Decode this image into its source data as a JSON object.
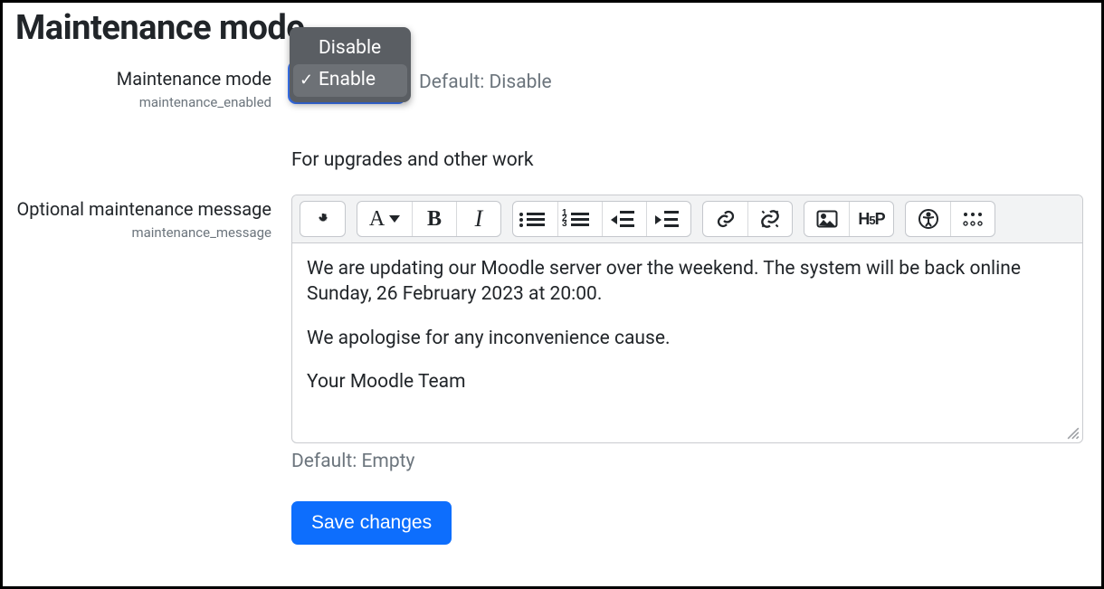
{
  "page_title": "Maintenance mode",
  "mode": {
    "label": "Maintenance mode",
    "key": "maintenance_enabled",
    "options": {
      "disable": "Disable",
      "enable": "Enable"
    },
    "selected": "Enable",
    "default_text": "Default: Disable",
    "help_text": "For upgrades and other work"
  },
  "message": {
    "label": "Optional maintenance message",
    "key": "maintenance_message",
    "body_p1": "We are updating our Moodle server over the weekend. The system will be back online Sunday, 26 February 2023 at 20:00.",
    "body_p2": "We apologise for any inconvenience cause.",
    "body_p3": "Your Moodle Team",
    "default_text": "Default: Empty"
  },
  "toolbar": {
    "h5p": "H-P"
  },
  "actions": {
    "save": "Save changes"
  }
}
